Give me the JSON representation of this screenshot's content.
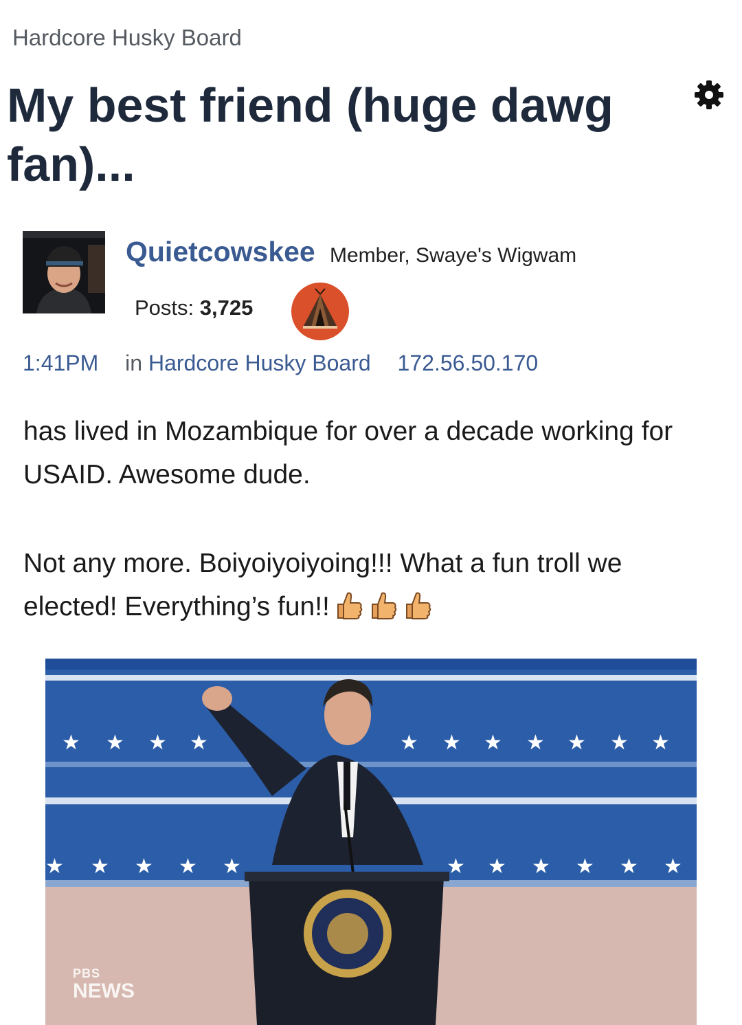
{
  "breadcrumb": "Hardcore Husky Board",
  "thread": {
    "title": "My best friend (huge dawg fan)..."
  },
  "author": {
    "username": "Quietcowskee",
    "role": "Member, Swaye's Wigwam",
    "posts_label": "Posts:",
    "posts_count": "3,725"
  },
  "meta": {
    "time": "1:41PM",
    "in_label": "in",
    "board": "Hardcore Husky Board",
    "ip": "172.56.50.170"
  },
  "post": {
    "paragraph1": "has lived in Mozambique for over a decade working for USAID. Awesome dude.",
    "paragraph2": "Not any more. Boiyoiyoiyoing!!! What a fun troll we elected! Everything’s fun!!"
  },
  "icons": {
    "settings": "gear-icon",
    "badge": "teepee-badge-icon",
    "reaction": "thumbs-up-emoji"
  },
  "media": {
    "watermark_line1": "PBS",
    "watermark_line2": "NEWS"
  },
  "colors": {
    "title": "#1e2a3c",
    "link": "#3a5a92",
    "badge": "#d9502a",
    "stage_blue": "#2c5da8"
  }
}
